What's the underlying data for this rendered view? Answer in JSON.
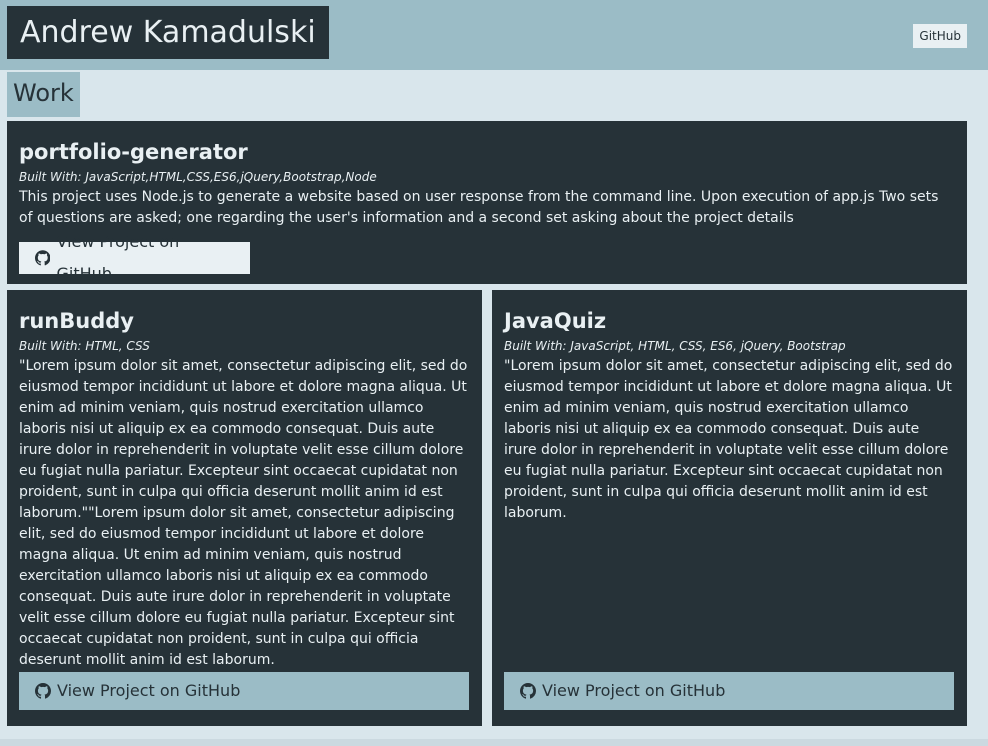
{
  "header": {
    "name": "Andrew Kamadulski",
    "github_link": "GitHub"
  },
  "section": {
    "title": "Work"
  },
  "projects": [
    {
      "title": "portfolio-generator",
      "built_with": "Built With: JavaScript,HTML,CSS,ES6,jQuery,Bootstrap,Node",
      "description": "This project uses Node.js to generate a website based on user response from the command line. Upon execution of app.js Two sets of questions are asked; one regarding the user's information and a second set asking about the project details",
      "button_label": "View Project on GitHub"
    },
    {
      "title": "runBuddy",
      "built_with": "Built With: HTML, CSS",
      "description": "\"Lorem ipsum dolor sit amet, consectetur adipiscing elit, sed do eiusmod tempor incididunt ut labore et dolore magna aliqua. Ut enim ad minim veniam, quis nostrud exercitation ullamco laboris nisi ut aliquip ex ea commodo consequat. Duis aute irure dolor in reprehenderit in voluptate velit esse cillum dolore eu fugiat nulla pariatur. Excepteur sint occaecat cupidatat non proident, sunt in culpa qui officia deserunt mollit anim id est laborum.\"\"Lorem ipsum dolor sit amet, consectetur adipiscing elit, sed do eiusmod tempor incididunt ut labore et dolore magna aliqua. Ut enim ad minim veniam, quis nostrud exercitation ullamco laboris nisi ut aliquip ex ea commodo consequat. Duis aute irure dolor in reprehenderit in voluptate velit esse cillum dolore eu fugiat nulla pariatur. Excepteur sint occaecat cupidatat non proident, sunt in culpa qui officia deserunt mollit anim id est laborum.",
      "button_label": "View Project on GitHub"
    },
    {
      "title": "JavaQuiz",
      "built_with": "Built With: JavaScript, HTML, CSS, ES6, jQuery, Bootstrap",
      "description": "\"Lorem ipsum dolor sit amet, consectetur adipiscing elit, sed do eiusmod tempor incididunt ut labore et dolore magna aliqua. Ut enim ad minim veniam, quis nostrud exercitation ullamco laboris nisi ut aliquip ex ea commodo consequat. Duis aute irure dolor in reprehenderit in voluptate velit esse cillum dolore eu fugiat nulla pariatur. Excepteur sint occaecat cupidatat non proident, sunt in culpa qui officia deserunt mollit anim id est laborum.",
      "button_label": "View Project on GitHub"
    }
  ],
  "colors": {
    "dark": "#263238",
    "accent": "#9bbcc6",
    "light": "#e9f0f3",
    "page_bg": "#d9e6ec"
  },
  "icons": {
    "project_button": "github-icon"
  }
}
